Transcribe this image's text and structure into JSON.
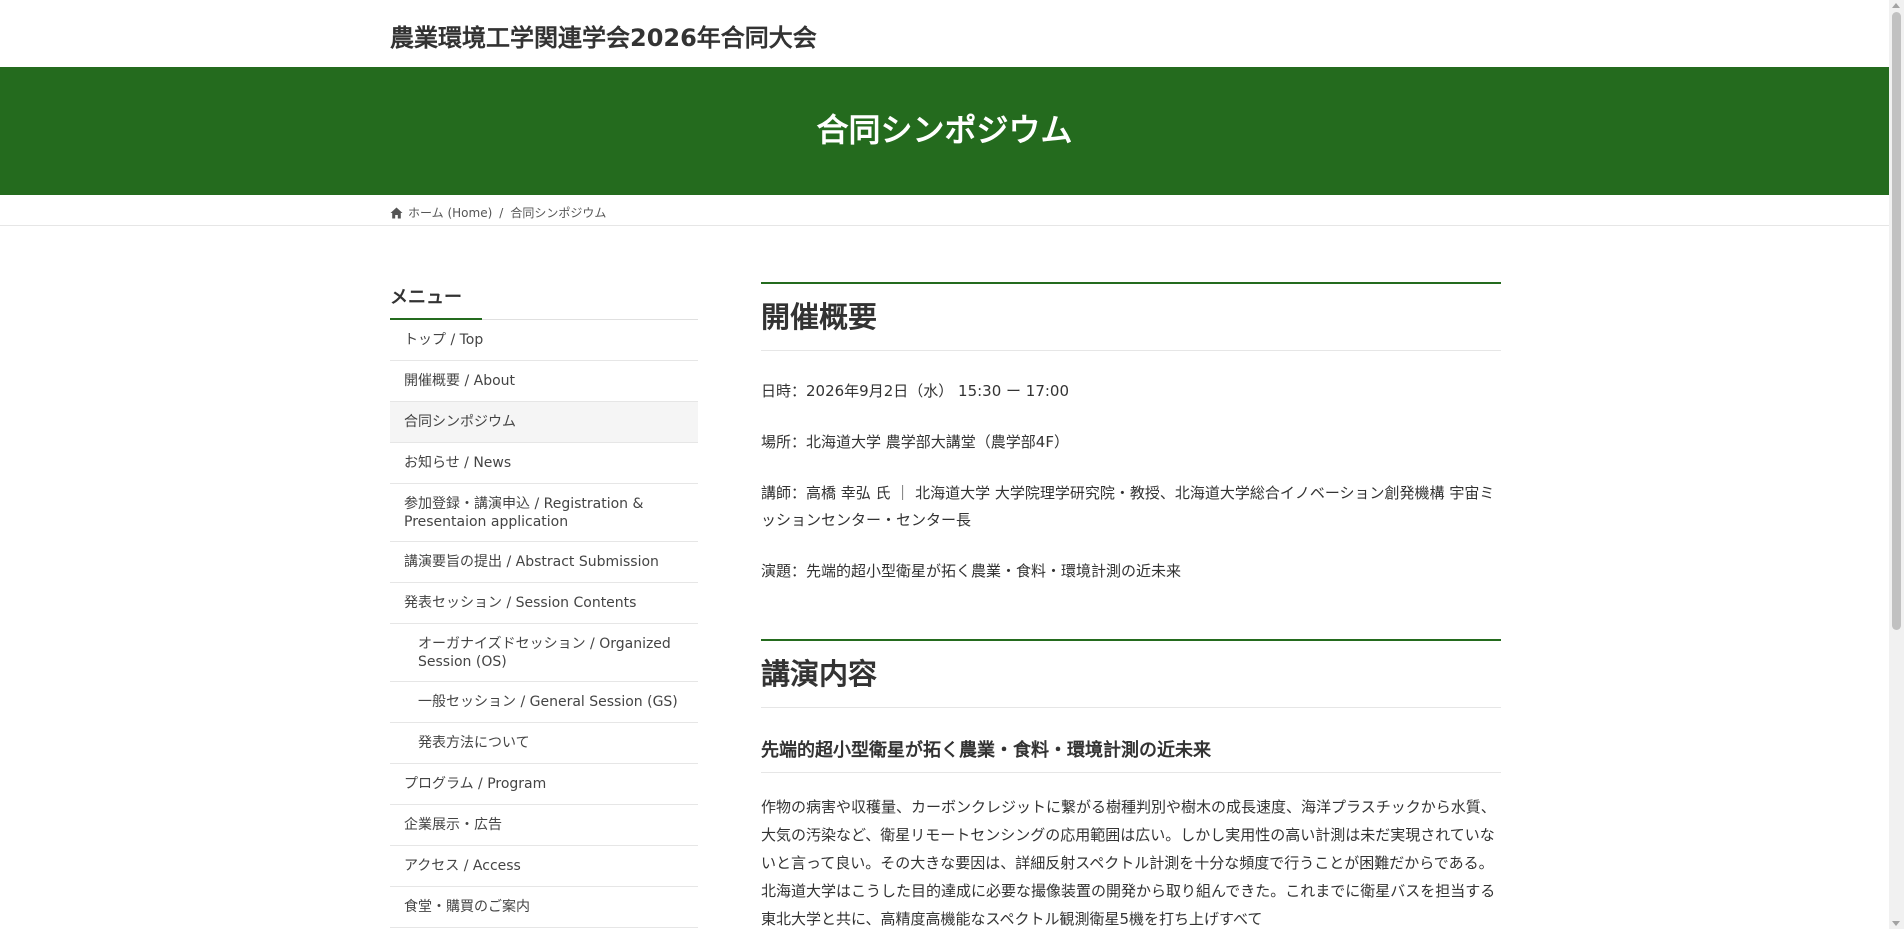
{
  "site": {
    "title": "農業環境工学関連学会2026年合同大会"
  },
  "banner": {
    "title": "合同シンポジウム"
  },
  "breadcrumb": {
    "home": "ホーム (Home)",
    "separator": "/",
    "current": "合同シンポジウム"
  },
  "sidebar": {
    "heading": "メニュー",
    "items": [
      {
        "label": "トップ / Top"
      },
      {
        "label": "開催概要 / About"
      },
      {
        "label": "合同シンポジウム"
      },
      {
        "label": "お知らせ / News"
      },
      {
        "label": "参加登録・講演申込 / Registration & Presentaion application"
      },
      {
        "label": "講演要旨の提出 / Abstract Submission"
      },
      {
        "label": "発表セッション / Session Contents"
      },
      {
        "label": "オーガナイズドセッション / Organized Session (OS)"
      },
      {
        "label": "一般セッション / General Session (GS)"
      },
      {
        "label": "発表方法について"
      },
      {
        "label": "プログラム / Program"
      },
      {
        "label": "企業展示・広告"
      },
      {
        "label": "アクセス / Access"
      },
      {
        "label": "食堂・購買のご案内"
      }
    ]
  },
  "main": {
    "overview": {
      "title": "開催概要",
      "datetime": "日時：2026年9月2日（水） 15:30 ー 17:00",
      "place": "場所：北海道大学 農学部大講堂（農学部4F）",
      "lecturer": "講師：高橋 幸弘 氏 ｜ 北海道大学 大学院理学研究院・教授、北海道大学総合イノベーション創発機構 宇宙ミッションセンター・センター長",
      "topic": "演題：先端的超小型衛星が拓く農業・食料・環境計測の近未来"
    },
    "lecture": {
      "title": "講演内容",
      "subtitle": "先端的超小型衛星が拓く農業・食料・環境計測の近未来",
      "body": "作物の病害や収穫量、カーボンクレジットに繋がる樹種判別や樹木の成長速度、海洋プラスチックから水質、大気の汚染など、衛星リモートセンシングの応用範囲は広い。しかし実用性の高い計測は未だ実現されていないと言って良い。その大きな要因は、詳細反射スペクトル計測を十分な頻度で行うことが困難だからである。北海道大学はこうした目的達成に必要な撮像装置の開発から取り組んできた。これまでに衛星バスを担当する東北大学と共に、高精度高機能なスペクトル観測衛星5機を打ち上げすべて"
    }
  },
  "colors": {
    "brand_green": "#246b1e"
  }
}
